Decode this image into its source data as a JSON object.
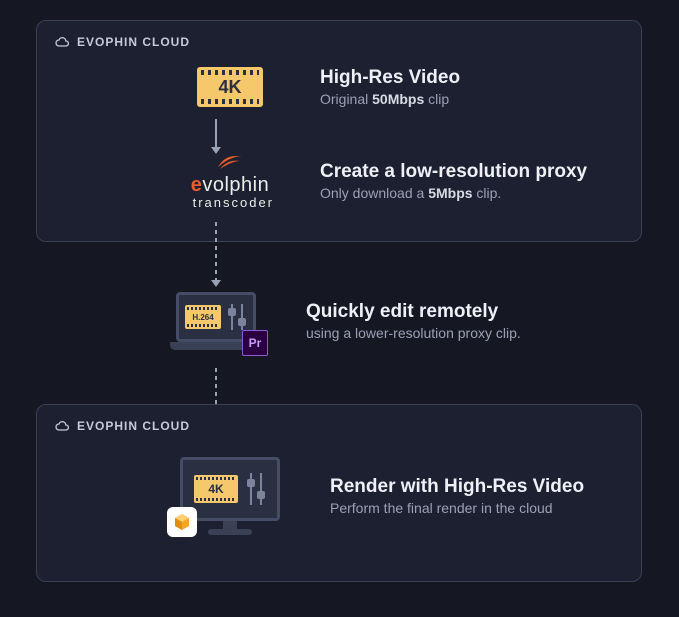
{
  "cloud_label": "EVOPHIN CLOUD",
  "step1": {
    "icon_text": "4K",
    "title": "High-Res Video",
    "sub_pre": "Original ",
    "sub_bold": "50Mbps",
    "sub_post": " clip"
  },
  "step2": {
    "brand_prefix": "e",
    "brand": "volphin",
    "sub": "transcoder",
    "title": "Create a low-resolution proxy",
    "sub_pre": "Only download a ",
    "sub_bold": "5Mbps",
    "sub_post": " clip."
  },
  "step3": {
    "codec": "H.264",
    "pr": "Pr",
    "title": "Quickly edit remotely",
    "sub": "using a lower-resolution proxy clip."
  },
  "step4": {
    "icon_text": "4K",
    "title": "Render with High-Res Video",
    "sub": "Perform the final render in the cloud"
  }
}
